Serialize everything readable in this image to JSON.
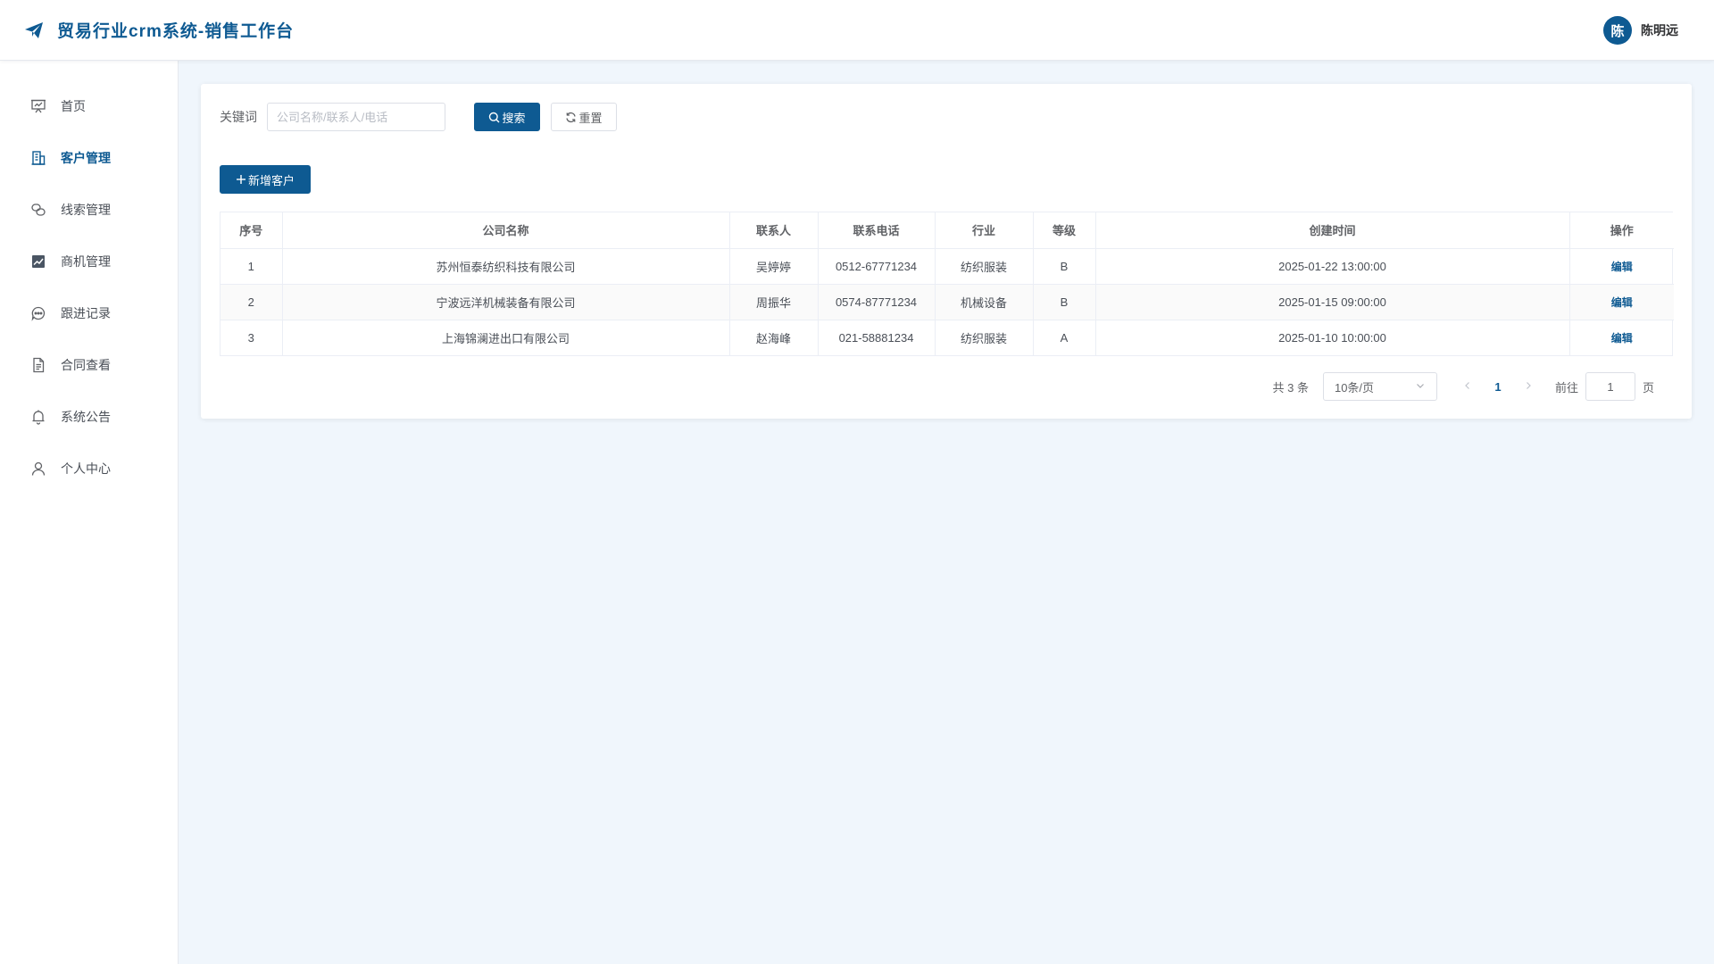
{
  "header": {
    "title": "贸易行业crm系统-销售工作台",
    "user_avatar_text": "陈",
    "user_name": "陈明远"
  },
  "sidebar": {
    "items": [
      {
        "label": "首页",
        "icon": "presentation-icon",
        "active": false
      },
      {
        "label": "客户管理",
        "icon": "building-icon",
        "active": true
      },
      {
        "label": "线索管理",
        "icon": "link-icon",
        "active": false
      },
      {
        "label": "商机管理",
        "icon": "trend-chart-icon",
        "active": false
      },
      {
        "label": "跟进记录",
        "icon": "chat-dots-icon",
        "active": false
      },
      {
        "label": "合同查看",
        "icon": "document-icon",
        "active": false
      },
      {
        "label": "系统公告",
        "icon": "bell-icon",
        "active": false
      },
      {
        "label": "个人中心",
        "icon": "user-icon",
        "active": false
      }
    ]
  },
  "search": {
    "label": "关键词",
    "placeholder": "公司名称/联系人/电话",
    "value": "",
    "search_label": "搜索",
    "reset_label": "重置"
  },
  "toolbar": {
    "add_label": "新增客户"
  },
  "table": {
    "columns": [
      "序号",
      "公司名称",
      "联系人",
      "联系电话",
      "行业",
      "等级",
      "创建时间",
      "操作"
    ],
    "rows": [
      {
        "index": "1",
        "company": "苏州恒泰纺织科技有限公司",
        "contact": "吴婷婷",
        "phone": "0512-67771234",
        "industry": "纺织服装",
        "level": "B",
        "created": "2025-01-22 13:00:00",
        "action": "编辑"
      },
      {
        "index": "2",
        "company": "宁波远洋机械装备有限公司",
        "contact": "周振华",
        "phone": "0574-87771234",
        "industry": "机械设备",
        "level": "B",
        "created": "2025-01-15 09:00:00",
        "action": "编辑"
      },
      {
        "index": "3",
        "company": "上海锦澜进出口有限公司",
        "contact": "赵海峰",
        "phone": "021-58881234",
        "industry": "纺织服装",
        "level": "A",
        "created": "2025-01-10 10:00:00",
        "action": "编辑"
      }
    ]
  },
  "pagination": {
    "total_text": "共 3 条",
    "page_size": "10条/页",
    "current_page": "1",
    "goto_label": "前往",
    "goto_value": "1",
    "page_unit": "页"
  },
  "colors": {
    "primary": "#0e5a92",
    "background": "#f0f6fc"
  }
}
